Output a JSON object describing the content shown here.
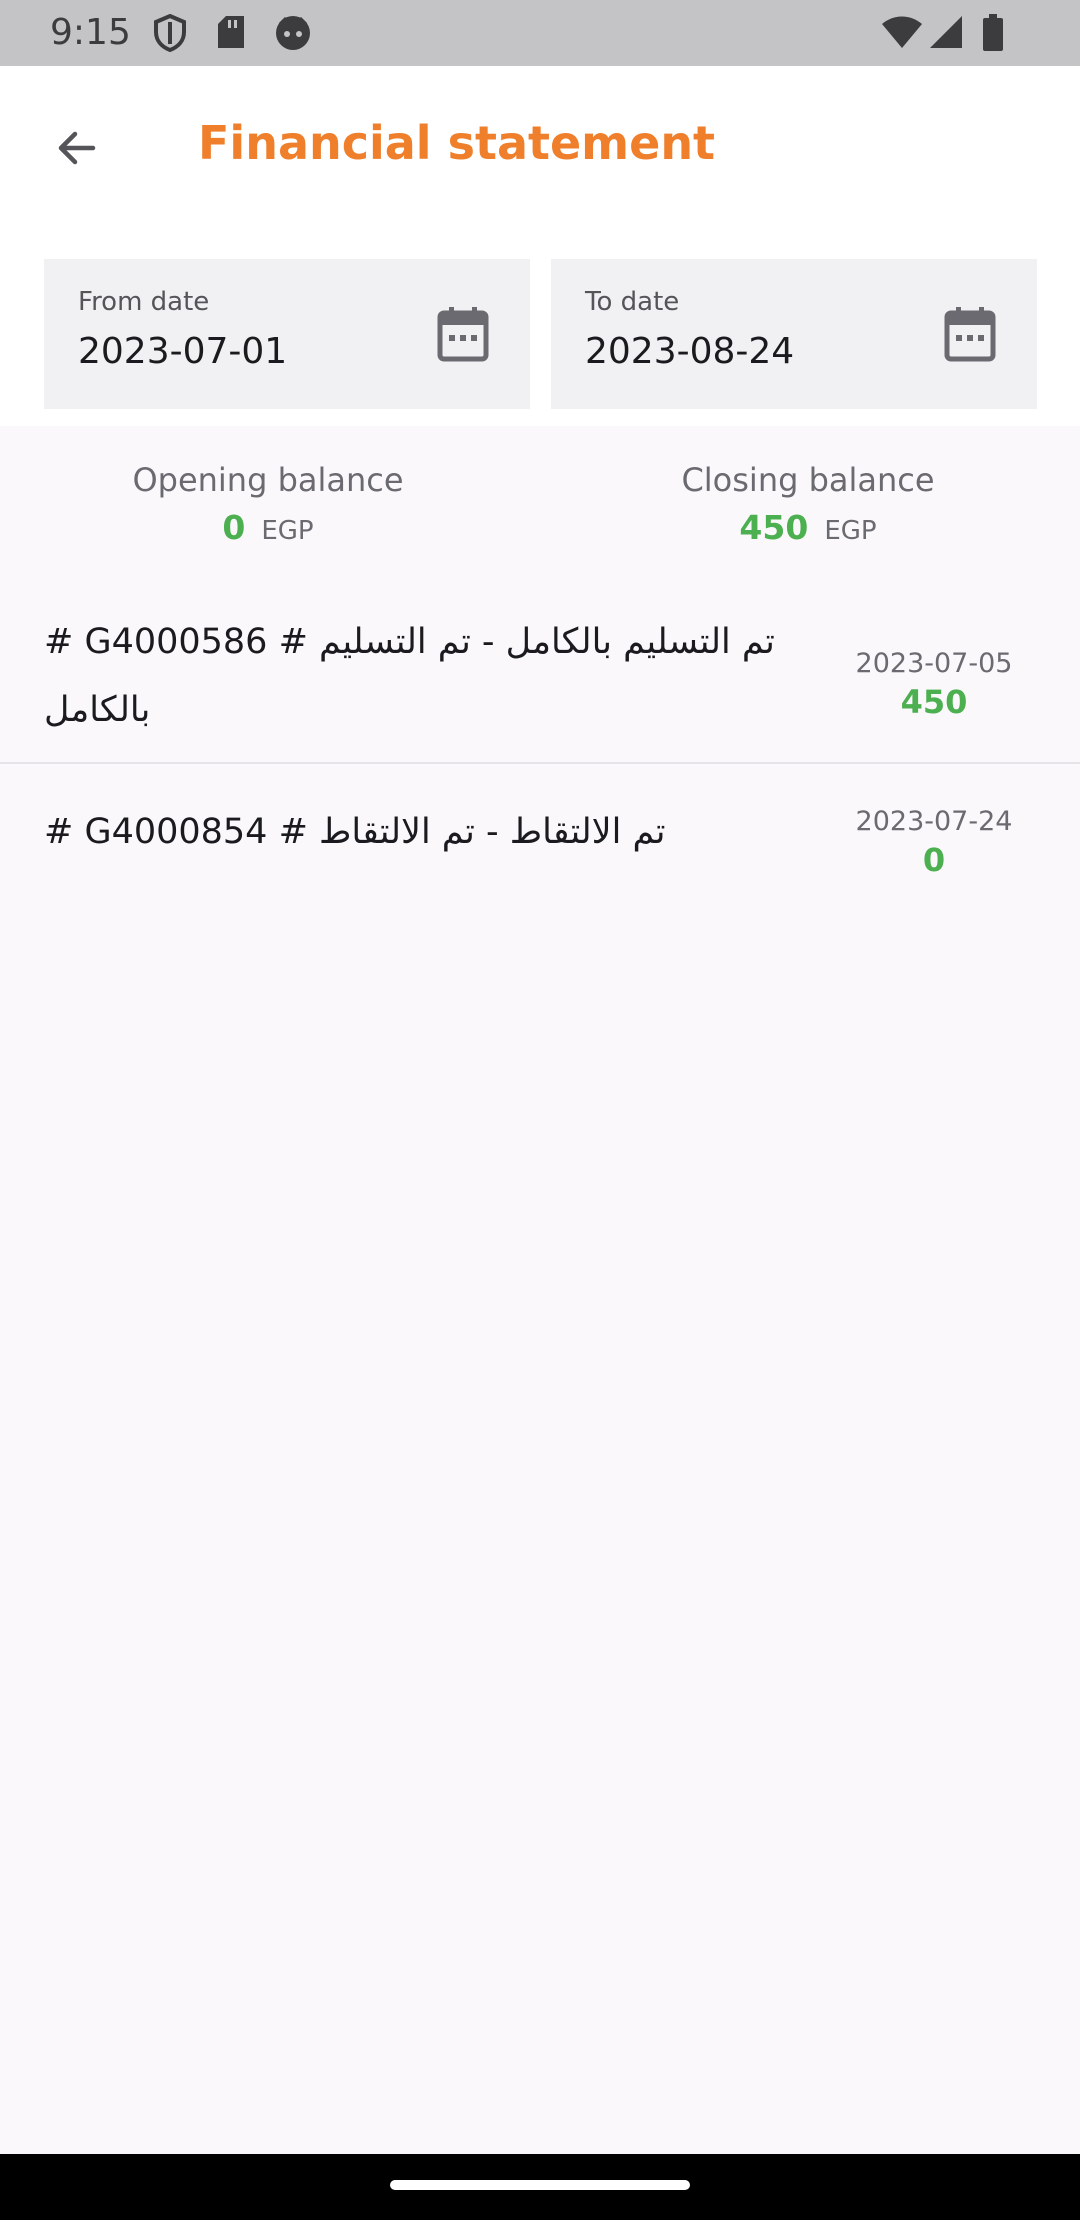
{
  "status_bar": {
    "time": "9:15",
    "left_icons": [
      "shield-icon",
      "sd-card-icon",
      "face-icon"
    ],
    "right_icons": [
      "wifi-icon",
      "signal-icon",
      "battery-icon"
    ]
  },
  "header": {
    "title": "Financial statement",
    "back_icon": "arrow-back-icon",
    "title_color": "#ef7f2b"
  },
  "filters": {
    "from": {
      "label": "From date",
      "value": "2023-07-01",
      "icon": "calendar-icon"
    },
    "to": {
      "label": "To date",
      "value": "2023-08-24",
      "icon": "calendar-icon"
    }
  },
  "balances": {
    "opening": {
      "label": "Opening balance",
      "amount": "0",
      "currency": "EGP"
    },
    "closing": {
      "label": "Closing balance",
      "amount": "450",
      "currency": "EGP"
    },
    "amount_color": "#4caf50"
  },
  "transactions": [
    {
      "description": "تم التسليم بالكامل - تم التسليم # G4000586 # بالكامل",
      "date": "2023-07-05",
      "amount": "450"
    },
    {
      "description": "تم الالتقاط - تم الالتقاط # G4000854 #",
      "date": "2023-07-24",
      "amount": "0"
    }
  ]
}
